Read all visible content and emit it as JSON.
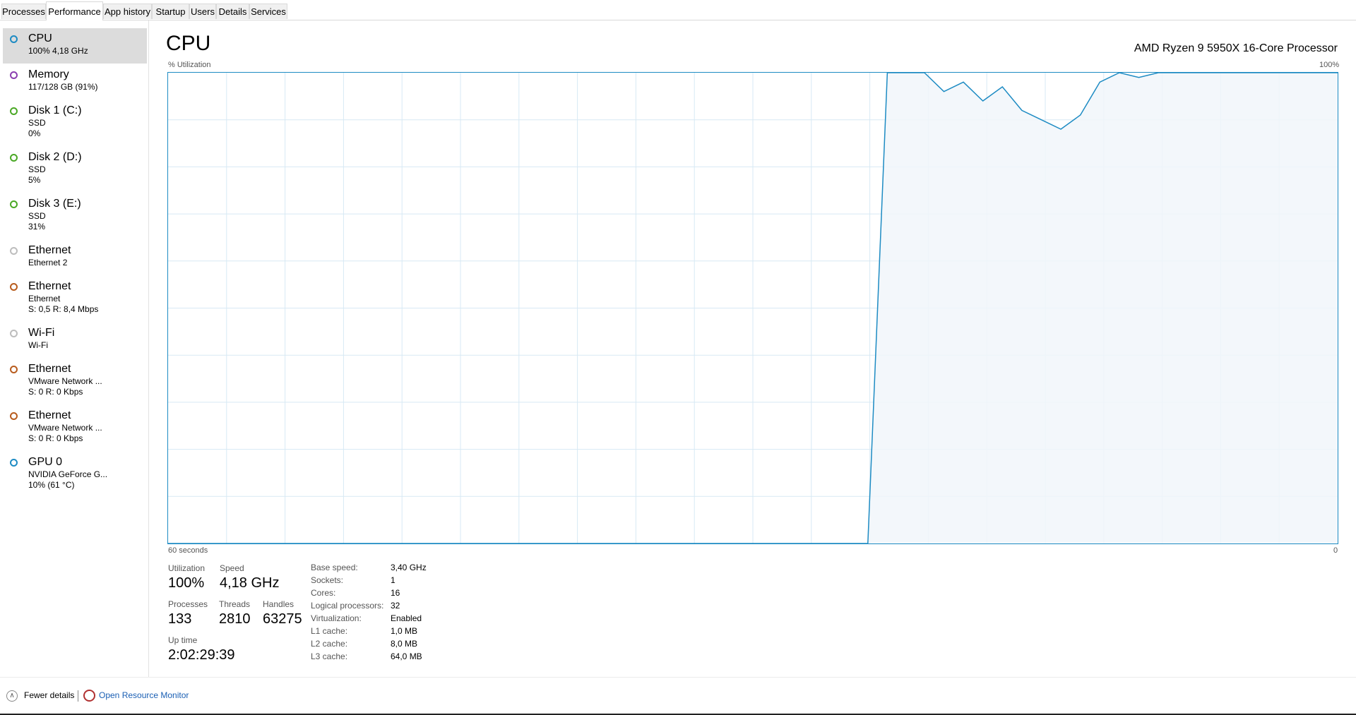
{
  "tabs": [
    "Processes",
    "Performance",
    "App history",
    "Startup",
    "Users",
    "Details",
    "Services"
  ],
  "active_tab": "Performance",
  "sidebar": {
    "items": [
      {
        "name": "CPU",
        "sub1": "100% 4,18 GHz",
        "sub2": "",
        "color": "#1d8bc3",
        "selected": true
      },
      {
        "name": "Memory",
        "sub1": "117/128 GB (91%)",
        "sub2": "",
        "color": "#8b3fb0",
        "selected": false
      },
      {
        "name": "Disk 1 (C:)",
        "sub1": "SSD",
        "sub2": "0%",
        "color": "#4aa825",
        "selected": false
      },
      {
        "name": "Disk 2 (D:)",
        "sub1": "SSD",
        "sub2": "5%",
        "color": "#4aa825",
        "selected": false
      },
      {
        "name": "Disk 3 (E:)",
        "sub1": "SSD",
        "sub2": "31%",
        "color": "#4aa825",
        "selected": false
      },
      {
        "name": "Ethernet",
        "sub1": "Ethernet 2",
        "sub2": "",
        "color": "#bdbdbd",
        "selected": false
      },
      {
        "name": "Ethernet",
        "sub1": "Ethernet",
        "sub2": "S: 0,5  R: 8,4 Mbps",
        "color": "#b85c1e",
        "selected": false
      },
      {
        "name": "Wi-Fi",
        "sub1": "Wi-Fi",
        "sub2": "",
        "color": "#bdbdbd",
        "selected": false
      },
      {
        "name": "Ethernet",
        "sub1": "VMware Network ...",
        "sub2": "S: 0  R: 0 Kbps",
        "color": "#b85c1e",
        "selected": false
      },
      {
        "name": "Ethernet",
        "sub1": "VMware Network ...",
        "sub2": "S: 0  R: 0 Kbps",
        "color": "#b85c1e",
        "selected": false
      },
      {
        "name": "GPU 0",
        "sub1": "NVIDIA GeForce G...",
        "sub2": "10% (61 °C)",
        "color": "#1d8bc3",
        "selected": false
      }
    ]
  },
  "main": {
    "title": "CPU",
    "processor": "AMD Ryzen 9 5950X 16-Core Processor",
    "y_label": "% Utilization",
    "y_max_label": "100%",
    "x_left_label": "60 seconds",
    "x_right_label": "0"
  },
  "chart_data": {
    "type": "area",
    "title": "",
    "xlabel": "",
    "ylabel": "% Utilization",
    "xlim": [
      60,
      0
    ],
    "ylim": [
      0,
      100
    ],
    "grid": true,
    "series": [
      {
        "x": [
          60,
          24.1,
          23.1,
          21.2,
          20.2,
          19.2,
          18.2,
          17.2,
          16.2,
          15.2,
          14.2,
          13.2,
          12.2,
          11.2,
          10.2,
          9.2,
          8.2,
          7.2,
          6.0,
          5.0,
          4.0,
          3.0,
          2.0,
          1.0,
          0
        ],
        "y": [
          0,
          0,
          100,
          100,
          96,
          98,
          94,
          97,
          92,
          90,
          88,
          91,
          98,
          100,
          99,
          100,
          100,
          100,
          100,
          100,
          100,
          100,
          100,
          100,
          100
        ]
      }
    ]
  },
  "stats": {
    "utilization_label": "Utilization",
    "utilization_value": "100%",
    "speed_label": "Speed",
    "speed_value": "4,18 GHz",
    "processes_label": "Processes",
    "processes_value": "133",
    "threads_label": "Threads",
    "threads_value": "2810",
    "handles_label": "Handles",
    "handles_value": "63275",
    "uptime_label": "Up time",
    "uptime_value": "2:02:29:39"
  },
  "specs": [
    {
      "label": "Base speed:",
      "value": "3,40 GHz"
    },
    {
      "label": "Sockets:",
      "value": "1"
    },
    {
      "label": "Cores:",
      "value": "16"
    },
    {
      "label": "Logical processors:",
      "value": "32"
    },
    {
      "label": "Virtualization:",
      "value": "Enabled"
    },
    {
      "label": "L1 cache:",
      "value": "1,0 MB"
    },
    {
      "label": "L2 cache:",
      "value": "8,0 MB"
    },
    {
      "label": "L3 cache:",
      "value": "64,0 MB"
    }
  ],
  "footer": {
    "fewer_details": "Fewer details",
    "open_resource_monitor": "Open Resource Monitor"
  },
  "colors": {
    "accent": "#1d8bc3",
    "grid": "#d7e9f4",
    "fill": "#f1f6fa"
  }
}
